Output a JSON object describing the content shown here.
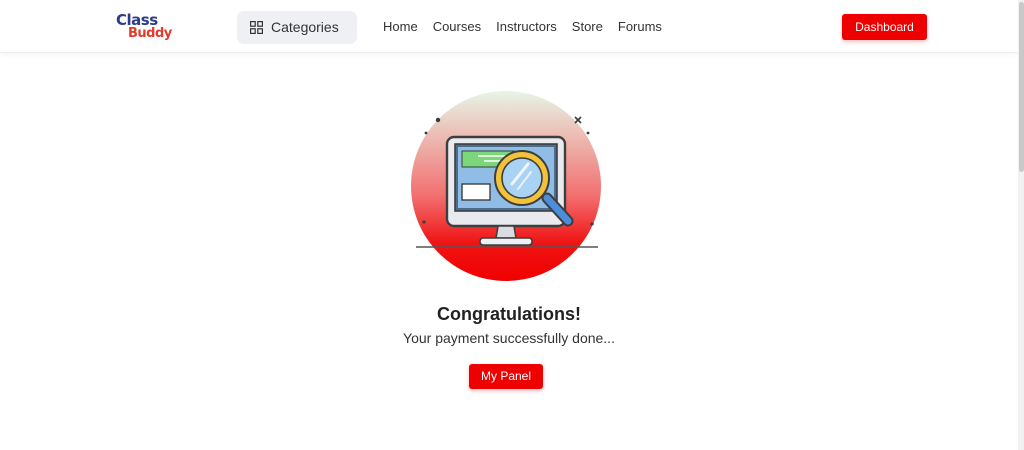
{
  "brand": {
    "line1": "Class",
    "line2": "Buddy"
  },
  "header": {
    "categories_label": "Categories",
    "nav": [
      "Home",
      "Courses",
      "Instructors",
      "Store",
      "Forums"
    ],
    "dashboard_label": "Dashboard"
  },
  "main": {
    "title": "Congratulations!",
    "message": "Your payment successfully done...",
    "panel_label": "My Panel"
  },
  "colors": {
    "accent": "#ee0000",
    "brand_blue": "#2b3a8a",
    "brand_red": "#e23b2e"
  }
}
